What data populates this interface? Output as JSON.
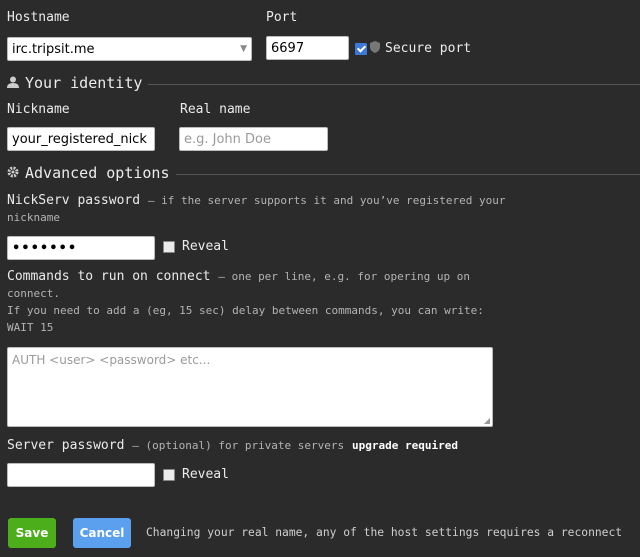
{
  "connection": {
    "hostname_label": "Hostname",
    "hostname_value": "irc.tripsit.me",
    "port_label": "Port",
    "port_value": "6697",
    "secure_port_label": "Secure port",
    "secure_port_checked": true
  },
  "identity": {
    "section_title": "Your identity",
    "nickname_label": "Nickname",
    "nickname_value": "your_registered_nick",
    "realname_label": "Real name",
    "realname_placeholder": "e.g. John Doe"
  },
  "advanced": {
    "section_title": "Advanced options",
    "nickserv_label": "NickServ password",
    "nickserv_hint": "— if the server supports it and you’ve registered your nickname",
    "nickserv_value": "•••••••",
    "reveal_label": "Reveal",
    "commands_label": "Commands to run on connect",
    "commands_hint_1": "— one per line, e.g. for opering up on connect.",
    "commands_hint_2": "If you need to add a (eg, 15 sec) delay between commands, you can write: WAIT 15",
    "commands_placeholder": "AUTH <user> <password> etc...",
    "server_password_label": "Server password",
    "server_password_hint": "— (optional) for private servers",
    "server_password_upgrade": "upgrade required",
    "server_reveal_label": "Reveal"
  },
  "footer": {
    "save_label": "Save",
    "cancel_label": "Cancel",
    "note": "Changing your real name, any of the host settings requires a reconnect"
  },
  "colors": {
    "background": "#2b2b2b",
    "save": "#4cae1a",
    "cancel": "#5aa0ef"
  }
}
